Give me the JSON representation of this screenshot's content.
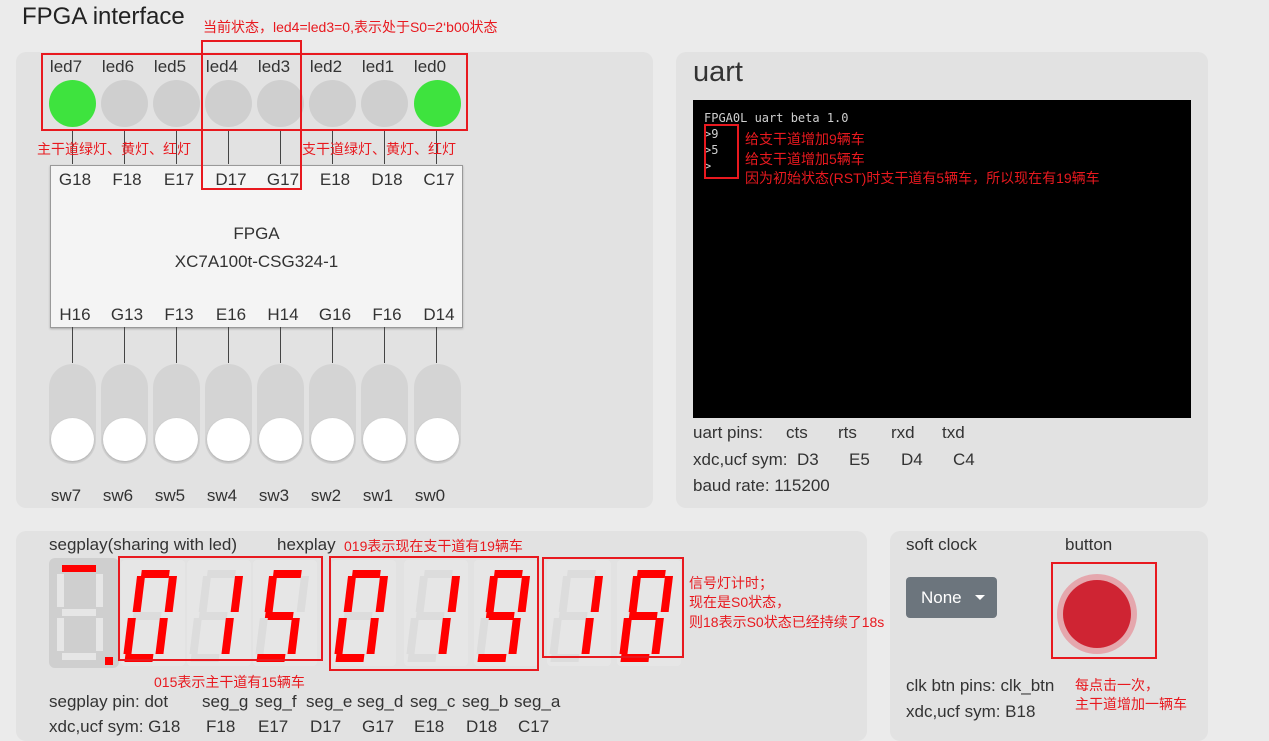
{
  "title": "FPGA interface",
  "leds": [
    {
      "label": "led7",
      "on": true
    },
    {
      "label": "led6",
      "on": false
    },
    {
      "label": "led5",
      "on": false
    },
    {
      "label": "led4",
      "on": false
    },
    {
      "label": "led3",
      "on": false
    },
    {
      "label": "led2",
      "on": false
    },
    {
      "label": "led1",
      "on": false
    },
    {
      "label": "led0",
      "on": true
    }
  ],
  "chip": {
    "name": "FPGA",
    "part": "XC7A100t-CSG324-1",
    "top_pins": [
      "G18",
      "F18",
      "E17",
      "D17",
      "G17",
      "E18",
      "D18",
      "C17"
    ],
    "bottom_pins": [
      "H16",
      "G13",
      "F13",
      "E16",
      "H14",
      "G16",
      "F16",
      "D14"
    ]
  },
  "switches": [
    "sw7",
    "sw6",
    "sw5",
    "sw4",
    "sw3",
    "sw2",
    "sw1",
    "sw0"
  ],
  "uart": {
    "title": "uart",
    "terminal_lines": [
      "FPGA0L uart beta 1.0",
      ">9",
      ">5",
      ">"
    ],
    "pins_label": "uart pins:",
    "pins": [
      "cts",
      "rts",
      "rxd",
      "txd"
    ],
    "sym_label": "xdc,ucf sym:",
    "syms": [
      "D3",
      "E5",
      "D4",
      "C4"
    ],
    "baud": "baud rate: 115200"
  },
  "seg": {
    "label": "segplay(sharing with led)",
    "hex_label": "hexplay",
    "digits": [
      "0",
      "1",
      "5",
      "0",
      "1",
      "9",
      "1",
      "8"
    ],
    "pin_label": "segplay pin: dot",
    "pins": [
      "seg_g",
      "seg_f",
      "seg_e",
      "seg_d",
      "seg_c",
      "seg_b",
      "seg_a"
    ],
    "sym_label": "xdc,ucf sym: G18",
    "syms": [
      "F18",
      "E17",
      "D17",
      "G17",
      "E18",
      "D18",
      "C17"
    ]
  },
  "clock": {
    "label": "soft clock",
    "button_label": "button",
    "select_value": "None",
    "pins_text": "clk btn pins: clk_btn",
    "sym_text": "xdc,ucf sym: B18"
  },
  "annotations": {
    "state": "当前状态，led4=led3=0,表示处于S0=2‘b00状态",
    "main_lights": "主干道绿灯、黄灯、红灯",
    "branch_lights": "支干道绿灯、黄灯、红灯",
    "uart_1": "给支干道增加9辆车",
    "uart_2": "给支干道增加5辆车",
    "uart_3": "因为初始状态(RST)时支干道有5辆车，所以现在有19辆车",
    "hex_note": "019表示现在支干道有19辆车",
    "timer_1": "信号灯计时；",
    "timer_2": "现在是S0状态，",
    "timer_3": "则18表示S0状态已经持续了18s",
    "main_note": "015表示主干道有15辆车",
    "button_1": "每点击一次，",
    "button_2": "主干道增加一辆车"
  },
  "colors": {
    "led_on": "#3ee33e",
    "segment_on": "#ff0000",
    "segment_off": "#dcdcdc",
    "annotation": "#e8191f",
    "button": "#cf2433"
  }
}
